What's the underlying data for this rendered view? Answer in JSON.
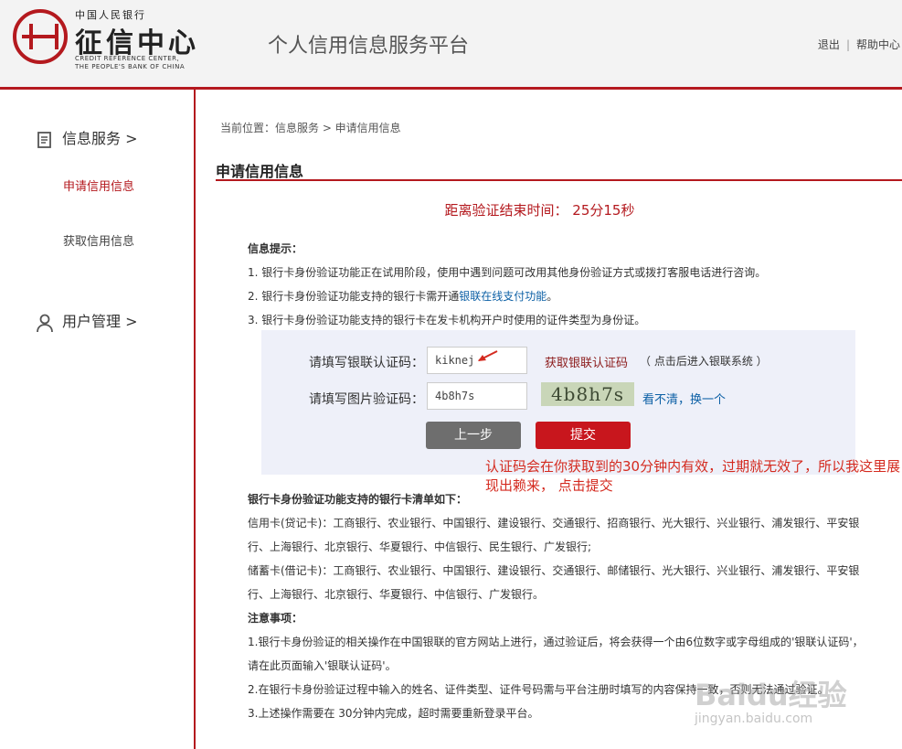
{
  "header": {
    "logo_top": "中国人民银行",
    "logo_main": "征信中心",
    "logo_en": "CREDIT REFERENCE CENTER,\nTHE PEOPLE'S BANK OF CHINA",
    "platform_title": "个人信用信息服务平台",
    "logout": "退出",
    "separator": "|",
    "help": "帮助中心"
  },
  "sidebar": {
    "info_service": "信息服务 >",
    "items": [
      "申请信用信息",
      "获取信用信息"
    ],
    "user_management": "用户管理 >"
  },
  "breadcrumb": "当前位置：信息服务 > 申请信用信息",
  "page_title": "申请信用信息",
  "countdown": "距离验证结束时间： 25分15秒",
  "tips": {
    "heading": "信息提示：",
    "line1": "1. 银行卡身份验证功能正在试用阶段，使用中遇到问题可改用其他身份验证方式或拨打客服电话进行咨询。",
    "line2_pre": "2. 银行卡身份验证功能支持的银行卡需开通",
    "line2_link": "银联在线支付功能",
    "line2_post": "。",
    "line3": "3. 银行卡身份验证功能支持的银行卡在发卡机构开户时使用的证件类型为身份证。"
  },
  "form": {
    "unionpay_label": "请填写银联认证码：",
    "unionpay_value": "kiknej",
    "get_code": "获取银联认证码",
    "get_code_hint": "（ 点击后进入银联系统 ）",
    "captcha_label": "请填写图片验证码：",
    "captcha_value": "4b8h7s",
    "captcha_image_text": "4b8h7s",
    "refresh": "看不清，换一个",
    "back": "上一步",
    "submit": "提交"
  },
  "annotation": "认证码会在你获取到的30分钟内有效，过期就无效了，所以我这里展现出赖来， 点击提交",
  "banks": {
    "heading": "银行卡身份验证功能支持的银行卡清单如下：",
    "credit_1": "信用卡(贷记卡)：工商银行、农业银行、中国银行、建设银行、交通银行、招商银行、光大银行、兴业银行、浦发银行、平安银",
    "credit_2": "行、上海银行、北京银行、华夏银行、中信银行、民生银行、广发银行;",
    "debit_1": "储蓄卡(借记卡)：工商银行、农业银行、中国银行、建设银行、交通银行、邮储银行、光大银行、兴业银行、浦发银行、平安银",
    "debit_2": "行、上海银行、北京银行、华夏银行、中信银行、广发银行。"
  },
  "notes": {
    "heading": "注意事项：",
    "n1a": "1.银行卡身份验证的相关操作在中国银联的官方网站上进行，通过验证后，将会获得一个由6位数字或字母组成的'银联认证码'，",
    "n1b": "请在此页面输入'银联认证码'。",
    "n2": "2.在银行卡身份验证过程中输入的姓名、证件类型、证件号码需与平台注册时填写的内容保持一致，否则无法通过验证。",
    "n3": "3.上述操作需要在 30分钟内完成，超时需要重新登录平台。"
  },
  "watermark": {
    "text": "Baidu经验",
    "sub": "jingyan.baidu.com"
  },
  "colors": {
    "brand_red": "#b4191e",
    "link_blue": "#0b5fa5",
    "submit_red": "#c8161d",
    "annotation_red": "#d42a1f"
  }
}
